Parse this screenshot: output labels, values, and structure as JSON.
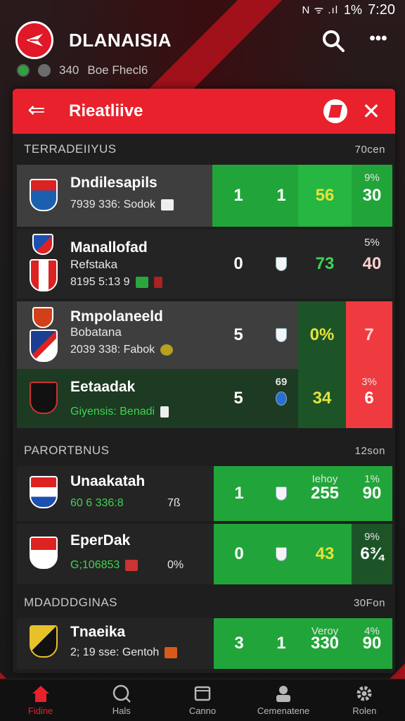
{
  "status": {
    "indicators": "N ᯤ .ıl",
    "battery": "1%",
    "time": "7:20"
  },
  "app": {
    "title": "DLANAISIA",
    "sub_count": "340",
    "sub_text": "Boe Fhecl6"
  },
  "card": {
    "title": "Rieatliive",
    "sections": [
      {
        "title": "TERRADEIIYUS",
        "count": "70cen",
        "rows": [
          {
            "name": "Dndilesapils",
            "meta": "7939 336: Sodok",
            "c1": "1",
            "c2": "1",
            "c3": "56",
            "c4top": "9%",
            "c4": "30"
          },
          {
            "name": "Manallofad",
            "sub": "Refstaka",
            "meta": "8195 5:13 9",
            "c1": "0",
            "c3": "73",
            "c4top": "5%",
            "c4": "40"
          },
          {
            "name": "Rmpolaneeld",
            "sub": "Bobatana",
            "meta": "2039 338: Fabok",
            "c1": "5",
            "c3": "0%",
            "c4": "7"
          },
          {
            "name": "Eetaadak",
            "meta": "Giyensis: Benadi",
            "c1": "5",
            "c2top": "69",
            "c3": "34",
            "c4top": "3%",
            "c4": "6"
          }
        ]
      },
      {
        "title": "PARORTBNUS",
        "count": "12son",
        "rows": [
          {
            "name": "Unaakatah",
            "meta": "60 6 336:8",
            "extra": "7ß",
            "c1": "1",
            "c3top": "Iehoy",
            "c3": "255",
            "c4top": "1%",
            "c4": "90"
          },
          {
            "name": "EperDak",
            "meta": "G;106853",
            "extra": "0%",
            "c1": "0",
            "c3": "43",
            "c4top": "9%",
            "c4": "6¾"
          }
        ]
      },
      {
        "title": "MDADDDGINAS",
        "count": "30Fon",
        "rows": [
          {
            "name": "Tnaeika",
            "meta": "2; 19 sse: Gentoh",
            "c1": "3",
            "c2": "1",
            "c3top": "Veroy",
            "c3": "330",
            "c4top": "4%",
            "c4": "90"
          }
        ]
      }
    ]
  },
  "nav": [
    {
      "label": "Fidine",
      "icon": "home-icon"
    },
    {
      "label": "Hals",
      "icon": "search-icon"
    },
    {
      "label": "Canno",
      "icon": "window-icon"
    },
    {
      "label": "Cemenatene",
      "icon": "person-icon"
    },
    {
      "label": "Rolen",
      "icon": "gear-icon"
    }
  ],
  "colors": {
    "accent": "#e8212c",
    "green": "#21a53a",
    "red": "#ef3b3f",
    "yellow": "#e7e23a"
  }
}
